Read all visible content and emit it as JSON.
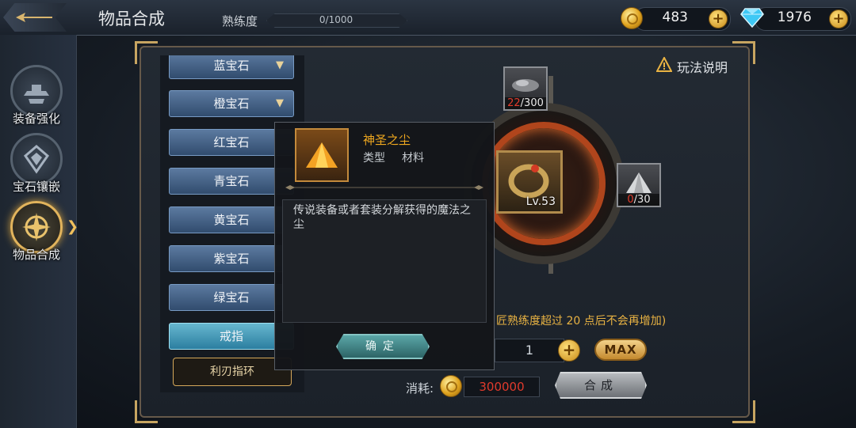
{
  "header": {
    "title": "物品合成",
    "proficiency_label": "熟练度",
    "proficiency_value": "0/1000",
    "proficiency_fraction": 0,
    "gold": "483",
    "diamonds": "1976"
  },
  "nav": {
    "items": [
      {
        "label": "装备强化",
        "icon": "anvil-icon"
      },
      {
        "label": "宝石镶嵌",
        "icon": "gem-icon"
      },
      {
        "label": "物品合成",
        "icon": "compass-icon",
        "active": true
      }
    ]
  },
  "panel": {
    "help_label": "玩法说明",
    "categories": [
      {
        "label": "蓝宝石"
      },
      {
        "label": "橙宝石"
      },
      {
        "label": "红宝石"
      },
      {
        "label": "青宝石"
      },
      {
        "label": "黄宝石"
      },
      {
        "label": "紫宝石"
      },
      {
        "label": "绿宝石"
      },
      {
        "label": "戒指"
      }
    ],
    "sub_item": "利刃指环"
  },
  "craft": {
    "material_top_have": "22",
    "material_top_need": "/300",
    "material_right_have": "0",
    "material_right_need": "/30",
    "result_level": "Lv.53",
    "note": "匠熟练度超过 20 点后不会再增加)",
    "quantity": "1",
    "max_label": "MAX",
    "cost_label": "消耗:",
    "cost_value": "300000",
    "craft_label": "合成"
  },
  "tooltip": {
    "name": "神圣之尘",
    "type_label": "类型",
    "type_value": "材料",
    "description": "传说装备或者套装分解获得的魔法之尘",
    "confirm_label": "确定"
  },
  "colors": {
    "gold_text": "#f0a81f",
    "warning_red": "#e23c2c",
    "note_orange": "#e9b343",
    "selected_tab": "#2b7ea0"
  }
}
